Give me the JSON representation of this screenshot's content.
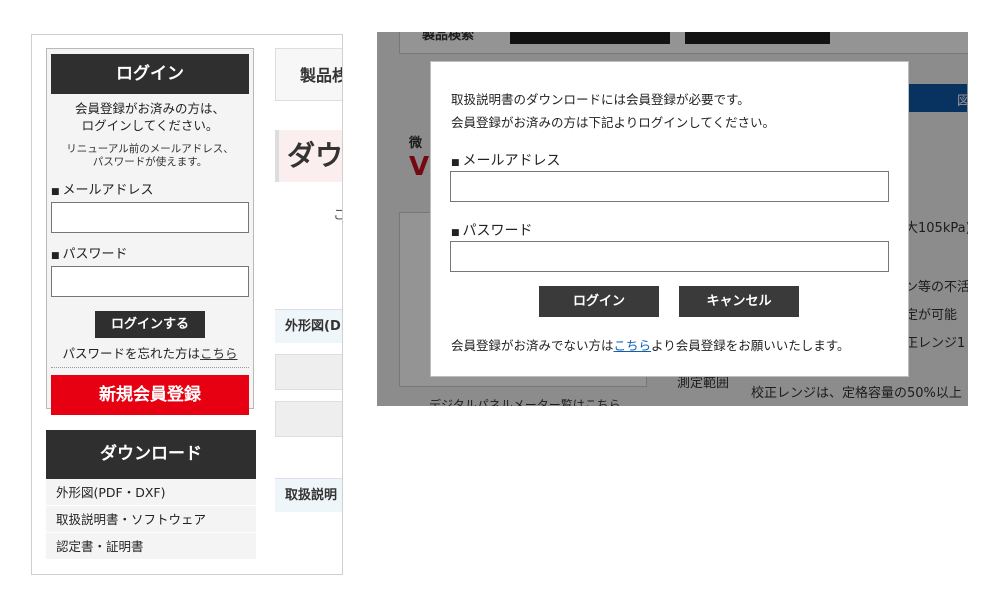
{
  "login": {
    "header": "ログイン",
    "msg_line1": "会員登録がお済みの方は、",
    "msg_line2": "ログインしてください。",
    "note_line1": "リニューアル前のメールアドレス、",
    "note_line2": "パスワードが使えます。",
    "email_label": "メールアドレス",
    "password_label": "パスワード",
    "login_button": "ログインする",
    "forgot_prefix": "パスワードを忘れた方は",
    "forgot_link": "こちら",
    "register_button": "新規会員登録"
  },
  "download": {
    "header": "ダウンロード",
    "items": [
      {
        "label": "外形図(PDF・DXF)"
      },
      {
        "label": "取扱説明書・ソフトウェア"
      },
      {
        "label": "認定書・証明書"
      }
    ]
  },
  "content_partial": {
    "tab_label": "製品桟",
    "title_partial": "ダウ",
    "char_partial": "こ",
    "section1_partial": "外形図(D",
    "section2_partial": "取扱説明"
  },
  "background_page": {
    "top_text": "製品検索",
    "side_small": "微",
    "side_red": "V",
    "frag_1": "大105kPa)",
    "frag_2": "ン等の不活",
    "frag_3": "定が可能",
    "frag_4": "正レンジ1",
    "frag_5": "校正レンジは、定格容量の50%以上",
    "frag_6": "測定範囲",
    "frag_7": "デジタルパネルメーター覧はこちら",
    "tab_frag": "図"
  },
  "modal": {
    "line1": "取扱説明書のダウンロードには会員登録が必要です。",
    "line2": "会員登録がお済みの方は下記よりログインしてください。",
    "email_label": "メールアドレス",
    "password_label": "パスワード",
    "login_button": "ログイン",
    "cancel_button": "キャンセル",
    "footer_prefix": "会員登録がお済みでない方は",
    "footer_link": "こちら",
    "footer_suffix": "より会員登録をお願いいたします。"
  },
  "colors": {
    "dark": "#2f2f2f",
    "register_red": "#e60012",
    "link_blue": "#1060b0",
    "brand_blue": "#0e57a6"
  }
}
